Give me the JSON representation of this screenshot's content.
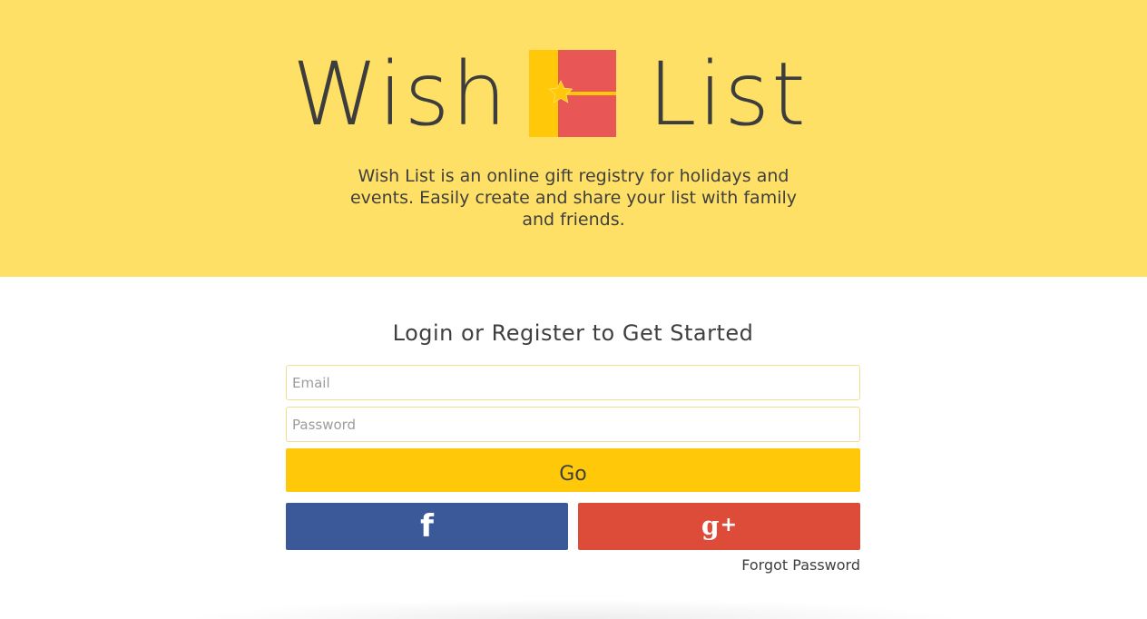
{
  "hero": {
    "logo_left": "Wish",
    "logo_right": "List",
    "logo_icon": "gift-box-icon",
    "tagline": "Wish List is an online gift registry for holidays and events. Easily create and share your list with family and friends.",
    "background_color": "#ffe066"
  },
  "login": {
    "title": "Login or Register to Get Started",
    "email_placeholder": "Email",
    "email_value": "",
    "password_placeholder": "Password",
    "password_value": "",
    "go_label": "Go",
    "go_color": "#ffc90a",
    "facebook": {
      "icon": "facebook-icon",
      "glyph": "f",
      "color": "#3b5998"
    },
    "google_plus": {
      "icon": "google-plus-icon",
      "glyph": "g",
      "plus": "+",
      "color": "#dd4b39"
    },
    "forgot_label": "Forgot Password"
  }
}
